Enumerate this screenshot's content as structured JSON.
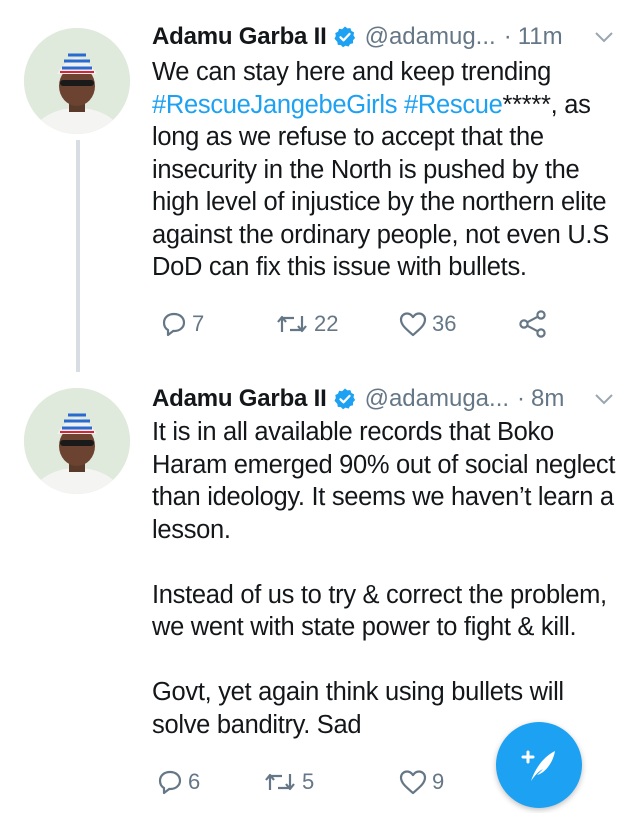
{
  "tweets": [
    {
      "author_name": "Adamu Garba II",
      "handle": "@adamug...",
      "dot": "·",
      "time": "11m",
      "text_plain_1": "We can stay here and keep trending",
      "hashtag_1": "#RescueJangebeGirls",
      "hashtag_2": "#Rescue",
      "text_after_hashtags": "*****, as long as we refuse to accept that the insecurity in the North is pushed by the high level of injustice by the northern elite against the ordinary people, not even U.S DoD can fix this issue with bullets.",
      "replies": "7",
      "retweets": "22",
      "likes": "36"
    },
    {
      "author_name": "Adamu Garba II",
      "handle": "@adamuga...",
      "dot": "·",
      "time": "8m",
      "paragraph_1": "It is in all available records that Boko Haram emerged 90% out of social neglect than ideology. It seems we haven’t learn a lesson.",
      "paragraph_2": "Instead of us to try & correct the problem, we went with state power to fight & kill.",
      "paragraph_3": "Govt, yet again think using bullets will solve banditry. Sad",
      "replies": "6",
      "retweets": "5",
      "likes": "9"
    }
  ],
  "colors": {
    "accent": "#1da1f2",
    "secondary_text": "#657786",
    "thread_line": "#d7dde2"
  },
  "icons": {
    "verified": "verified-badge-icon",
    "caret": "chevron-down-icon",
    "reply": "reply-icon",
    "retweet": "retweet-icon",
    "like": "heart-icon",
    "share": "share-icon",
    "compose": "compose-tweet-icon"
  }
}
